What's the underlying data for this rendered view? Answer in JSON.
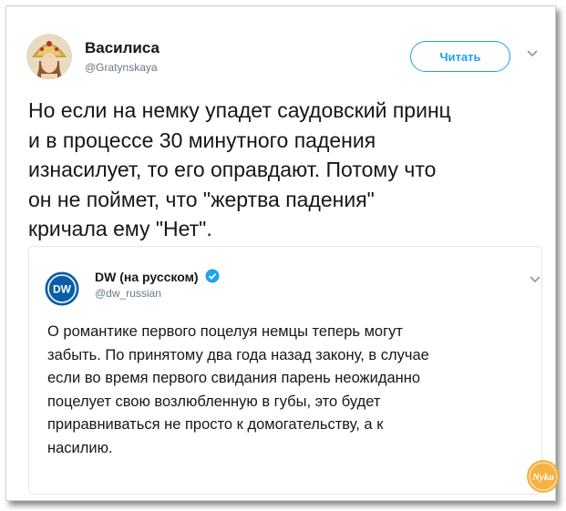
{
  "tweet": {
    "author": {
      "name": "Василиса",
      "handle": "@Gratynskaya",
      "avatar_icon": "avatar-woman-kokoshnik-icon"
    },
    "follow_label": "Читать",
    "menu_icon": "chevron-down-icon",
    "text": "Но если на немку упадет саудовский принц\nи в процессе 30 минутного падения\nизнасилует, то его оправдают. Потому что\nон не поймет, что \"жертва падения\"\nкричала ему \"Нет\".",
    "quoted": {
      "author": {
        "name": "DW (на русском)",
        "handle": "@dw_russian",
        "logo_text": "DW",
        "verified": true
      },
      "menu_icon": "chevron-down-icon",
      "text": "О романтике первого поцелуя немцы теперь могут\nзабыть. По принятому два года назад закону, в случае\nесли во время первого свидания парень неожиданно\nпоцелует свою возлюбленную в губы, это будет\nприравниваться не просто к домогательству, а к\nнасилию."
    }
  },
  "watermark": {
    "text": "Nyka"
  },
  "colors": {
    "accent": "#1da1f2",
    "text": "#14171a",
    "secondary": "#657786",
    "border": "#e1e8ed",
    "dw_blue": "#0a5ea8",
    "watermark_orange": "#f5a623"
  }
}
